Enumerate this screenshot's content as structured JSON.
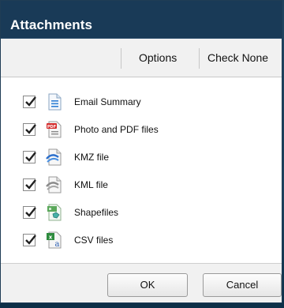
{
  "dialog": {
    "title": "Attachments",
    "toolbar": {
      "options_label": "Options",
      "check_none_label": "Check None"
    },
    "items": [
      {
        "label": "Email Summary",
        "checked": true,
        "icon": "document-icon"
      },
      {
        "label": "Photo and PDF files",
        "checked": true,
        "icon": "pdf-icon"
      },
      {
        "label": "KMZ file",
        "checked": true,
        "icon": "kmz-file-icon"
      },
      {
        "label": "KML file",
        "checked": true,
        "icon": "kml-file-icon"
      },
      {
        "label": "Shapefiles",
        "checked": true,
        "icon": "shapefile-icon"
      },
      {
        "label": "CSV files",
        "checked": true,
        "icon": "csv-file-icon"
      }
    ],
    "buttons": {
      "ok_label": "OK",
      "cancel_label": "Cancel"
    }
  },
  "colors": {
    "titlebar": "#193a57",
    "background": "#0d2f47",
    "panel": "#f1f1f1"
  }
}
